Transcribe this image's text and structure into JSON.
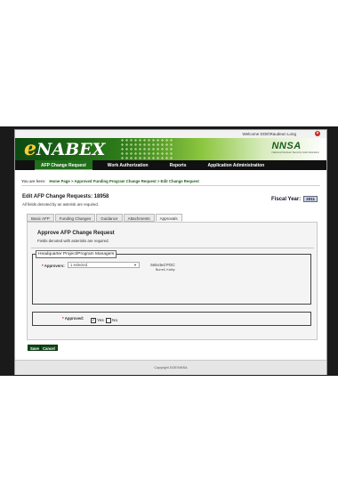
{
  "header": {
    "welcome_text": "Welcome DOE\\Raudeun Long",
    "app_name_initial": "e",
    "app_name_rest": "NABEX",
    "agency_logo": "NNSA",
    "agency_tagline": "National Nuclear Security Administration"
  },
  "nav": {
    "items": [
      {
        "label": "AFP Change Request",
        "active": true
      },
      {
        "label": "Work Authorization",
        "active": false
      },
      {
        "label": "Reports",
        "active": false
      },
      {
        "label": "Application Administration",
        "active": false
      }
    ]
  },
  "breadcrumb": {
    "label": "You are here:",
    "trail": "Home Page  >  Approved Funding Program Change Request  >  Edit Change Request"
  },
  "page": {
    "title": "Edit AFP Change Requests: 18958",
    "fiscal_year_label": "Fiscal Year:",
    "fiscal_year_value": "2011",
    "required_note": "All fields denoted by an asterisk are required."
  },
  "tabs": [
    {
      "label": "Basic AFP",
      "active": false
    },
    {
      "label": "Funding Changes",
      "active": false
    },
    {
      "label": "Guidance",
      "active": false
    },
    {
      "label": "Attachments",
      "active": false
    },
    {
      "label": "Approvals",
      "active": true
    }
  ],
  "approvals_panel": {
    "heading": "Approve AFP Change Request",
    "note": "Fields denoted with asterisks are required.",
    "fieldset_legend": "Headquarter Project/Program Managers",
    "approvers_label": "Approvers:",
    "approvers_value": "1 selected",
    "selected_poc_label": "Selected POC:",
    "selected_poc_name": "Burrell, Kathy",
    "approved_label": "Approved:",
    "yes_label": "Yes",
    "no_label": "No",
    "yes_checked": true,
    "no_checked": false
  },
  "actions": {
    "save_label": "Save",
    "cancel_label": "Cancel"
  },
  "footer": {
    "copyright": "Copyright DOE/NNSA"
  },
  "colors": {
    "brand_green": "#1f6e1a",
    "nav_bg": "#111111",
    "required": "#cc0000"
  }
}
